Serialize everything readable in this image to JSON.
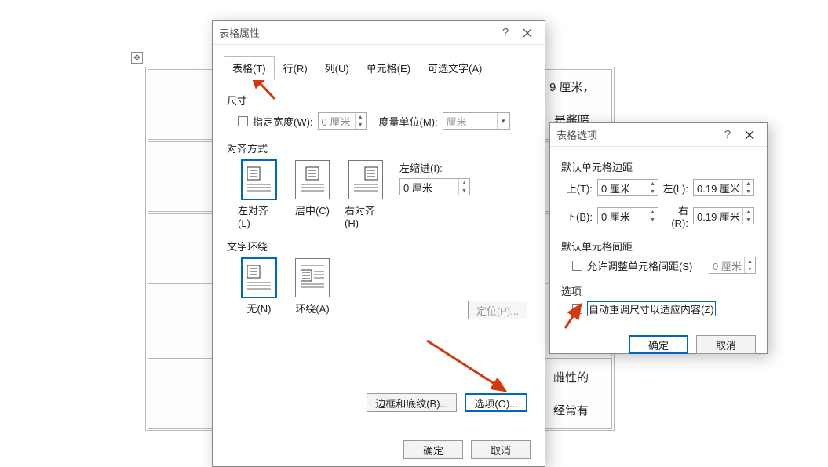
{
  "doc": {
    "frag1": "9 厘米，",
    "frag2": "是酱暗",
    "frag3": "雌性的",
    "frag4": "经常有"
  },
  "dlg1": {
    "title": "表格属性",
    "tabs": [
      "表格(T)",
      "行(R)",
      "列(U)",
      "单元格(E)",
      "可选文字(A)"
    ],
    "sec_size": "尺寸",
    "chk_width": "指定宽度(W):",
    "width_val": "0 厘米",
    "unit_label": "度量单位(M):",
    "unit_val": "厘米",
    "sec_align": "对齐方式",
    "align_opts": [
      "左对齐(L)",
      "居中(C)",
      "右对齐(H)"
    ],
    "indent_label": "左缩进(I):",
    "indent_val": "0 厘米",
    "sec_wrap": "文字环绕",
    "wrap_opts": [
      "无(N)",
      "环绕(A)"
    ],
    "btn_pos": "定位(P)...",
    "btn_border": "边框和底纹(B)...",
    "btn_options": "选项(O)...",
    "ok": "确定",
    "cancel": "取消"
  },
  "dlg2": {
    "title": "表格选项",
    "sec_margin": "默认单元格边距",
    "labels": {
      "top": "上(T):",
      "left": "左(L):",
      "bottom": "下(B):",
      "right": "右(R):"
    },
    "vals": {
      "top": "0 厘米",
      "left": "0.19 厘米",
      "bottom": "0 厘米",
      "right": "0.19 厘米"
    },
    "sec_spacing": "默认单元格间距",
    "chk_spacing": "允许调整单元格间距(S)",
    "spacing_val": "0 厘米",
    "sec_opt": "选项",
    "chk_auto": "自动重调尺寸以适应内容(Z)",
    "ok": "确定",
    "cancel": "取消"
  }
}
